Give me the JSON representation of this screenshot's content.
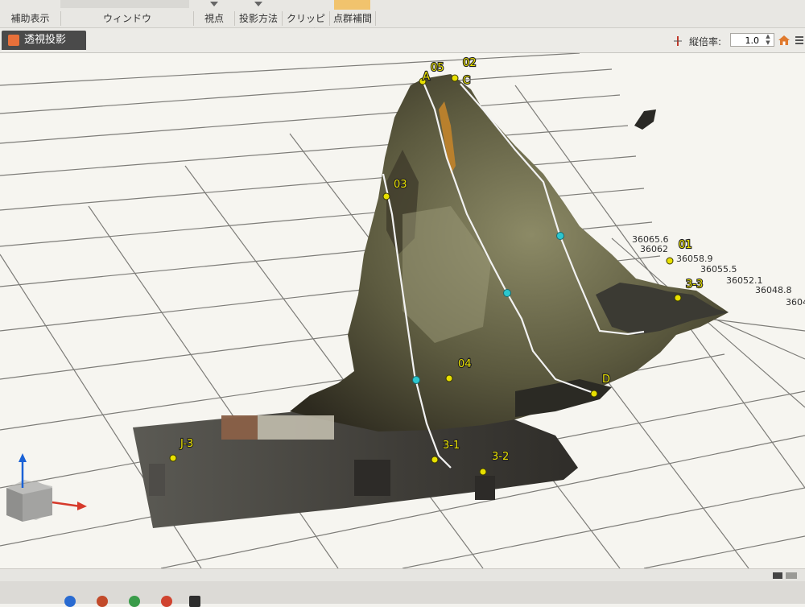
{
  "ribbon": {
    "groups": [
      {
        "label": "補助表示"
      },
      {
        "label": "ウィンドウ"
      },
      {
        "label": "視点"
      },
      {
        "label": "投影方法"
      },
      {
        "label": "クリッピング"
      },
      {
        "label": "点群補間"
      }
    ]
  },
  "tabbar": {
    "active_tab": "透視投影",
    "scale_label": "縦倍率:",
    "scale_value": "1.0"
  },
  "viewport": {
    "point_labels": [
      "05",
      "02",
      "A",
      "C",
      "03",
      "01",
      "3-3",
      "04",
      "D",
      "J-3",
      "3-1",
      "3-2"
    ],
    "elevation_values": [
      "36065.6",
      "36062",
      "36058.9",
      "36055.5",
      "36052.1",
      "36048.8",
      "3604"
    ]
  },
  "colors": {
    "grid_background": "#f6f5f0",
    "grid_lines": "#7d7c78",
    "point_marker": "#e8e000",
    "profile_line": "#f2f2f2",
    "waypoint": "#2cc7cf",
    "axis_z": "#1a62d6",
    "axis_x": "#d63a2b"
  }
}
